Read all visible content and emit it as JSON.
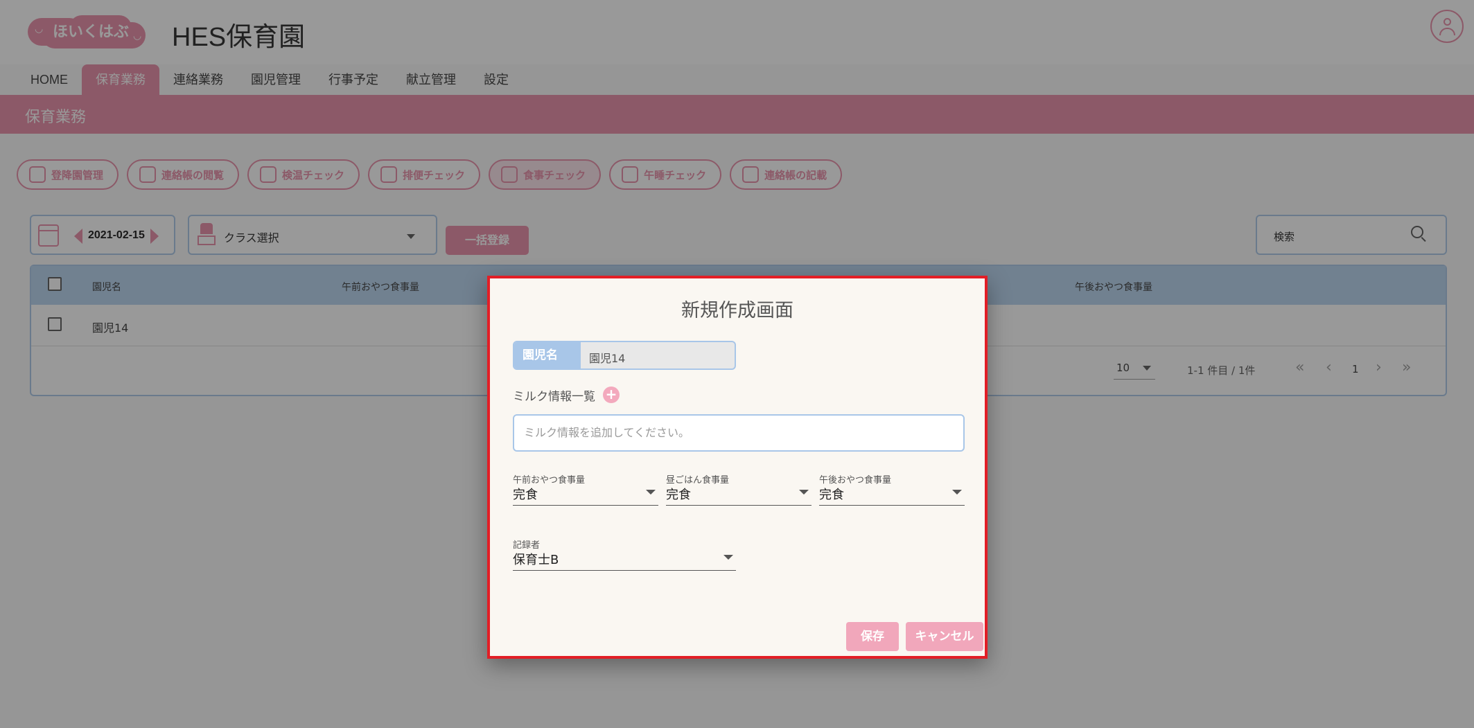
{
  "header": {
    "logo_text": "ほいくはぶ",
    "app_title": "HES保育園"
  },
  "nav": {
    "items": [
      "HOME",
      "保育業務",
      "連絡業務",
      "園児管理",
      "行事予定",
      "献立管理",
      "設定"
    ],
    "active": "保育業務"
  },
  "section_title": "保育業務",
  "function_buttons": [
    "登降園管理",
    "連絡帳の閲覧",
    "検温チェック",
    "排便チェック",
    "食事チェック",
    "午睡チェック",
    "連絡帳の記載"
  ],
  "toolbar": {
    "date": "2021-02-15",
    "class_select": "クラス選択",
    "bulk_register": "一括登録",
    "search_placeholder": "検索"
  },
  "table": {
    "headers": [
      "園児名",
      "午前おやつ食事量",
      "午後おやつ食事量"
    ],
    "rows": [
      {
        "name": "園児14"
      }
    ],
    "rows_per_page": "10",
    "range": "1-1 件目 / 1件",
    "page": "1"
  },
  "dialog": {
    "title": "新規作成画面",
    "child_label": "園児名",
    "child_value": "園児14",
    "milk_label": "ミルク情報一覧",
    "milk_add": "+",
    "milk_placeholder": "ミルク情報を追加してください。",
    "am_snack_label": "午前おやつ食事量",
    "am_snack_value": "完食",
    "lunch_label": "昼ごはん食事量",
    "lunch_value": "完食",
    "pm_snack_label": "午後おやつ食事量",
    "pm_snack_value": "完食",
    "recorder_label": "記録者",
    "recorder_value": "保育士B",
    "save_label": "保存",
    "cancel_label": "キャンセル"
  },
  "colors": {
    "brand_pink": "#e88aa4",
    "field_blue": "#a8c6e8",
    "dialog_border": "#e21e26"
  }
}
